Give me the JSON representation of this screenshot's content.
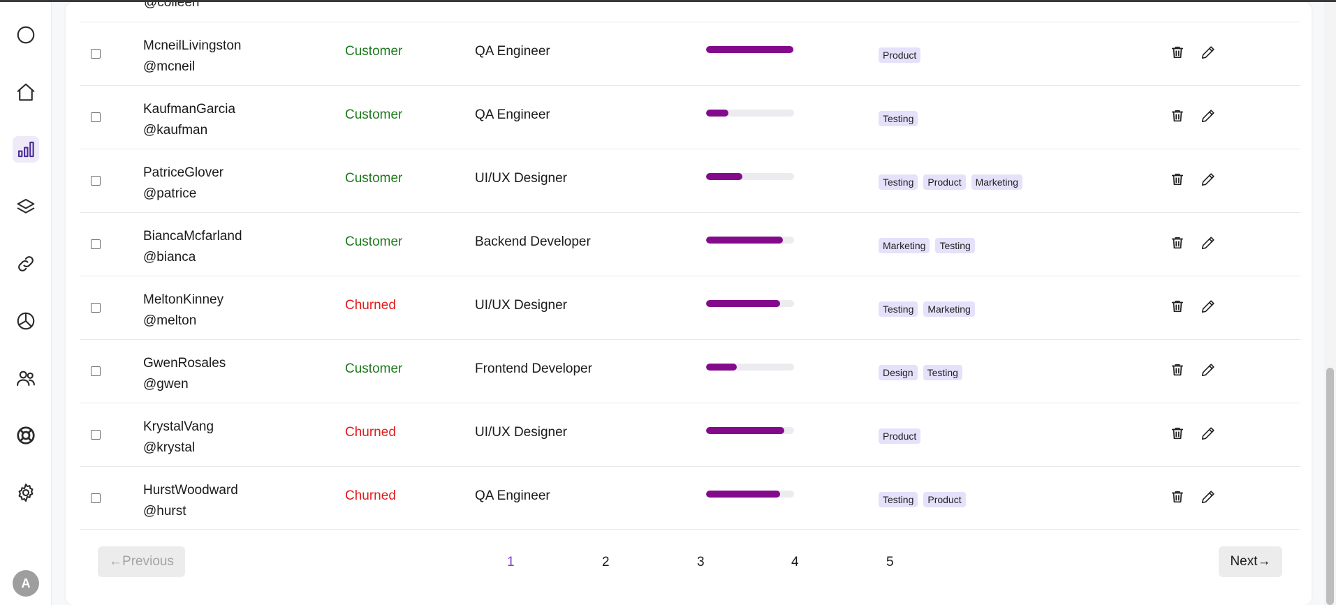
{
  "sidebar": {
    "icons": [
      "circle-icon",
      "home-icon",
      "bar-chart-icon",
      "layers-icon",
      "link-icon",
      "pie-chart-icon",
      "users-icon",
      "lifebuoy-icon",
      "gear-icon"
    ],
    "active": "bar-chart-icon",
    "avatar_initial": "A"
  },
  "table": {
    "partial_top_handle": "@colleen",
    "rows": [
      {
        "name": "McneilLivingston",
        "handle": "@mcneil",
        "status": "Customer",
        "role": "QA Engineer",
        "progress": 0.99,
        "tags": [
          "Product"
        ]
      },
      {
        "name": "KaufmanGarcia",
        "handle": "@kaufman",
        "status": "Customer",
        "role": "QA Engineer",
        "progress": 0.25,
        "tags": [
          "Testing"
        ]
      },
      {
        "name": "PatriceGlover",
        "handle": "@patrice",
        "status": "Customer",
        "role": "UI/UX Designer",
        "progress": 0.41,
        "tags": [
          "Testing",
          "Product",
          "Marketing"
        ]
      },
      {
        "name": "BiancaMcfarland",
        "handle": "@bianca",
        "status": "Customer",
        "role": "Backend Developer",
        "progress": 0.87,
        "tags": [
          "Marketing",
          "Testing"
        ]
      },
      {
        "name": "MeltonKinney",
        "handle": "@melton",
        "status": "Churned",
        "role": "UI/UX Designer",
        "progress": 0.84,
        "tags": [
          "Testing",
          "Marketing"
        ]
      },
      {
        "name": "GwenRosales",
        "handle": "@gwen",
        "status": "Customer",
        "role": "Frontend Developer",
        "progress": 0.35,
        "tags": [
          "Design",
          "Testing"
        ]
      },
      {
        "name": "KrystalVang",
        "handle": "@krystal",
        "status": "Churned",
        "role": "UI/UX Designer",
        "progress": 0.89,
        "tags": [
          "Product"
        ]
      },
      {
        "name": "HurstWoodward",
        "handle": "@hurst",
        "status": "Churned",
        "role": "QA Engineer",
        "progress": 0.84,
        "tags": [
          "Testing",
          "Product"
        ]
      }
    ]
  },
  "pagination": {
    "previous_label": "←Previous",
    "next_label": "Next→",
    "pages": [
      "1",
      "2",
      "3",
      "4",
      "5"
    ],
    "current": "1"
  },
  "colors": {
    "progress_fill": "#840a8c",
    "customer": "#1d7a1d",
    "churned": "#e01b1b",
    "tag_bg": "#e5e1fa",
    "current_page": "#7b3fd6"
  }
}
